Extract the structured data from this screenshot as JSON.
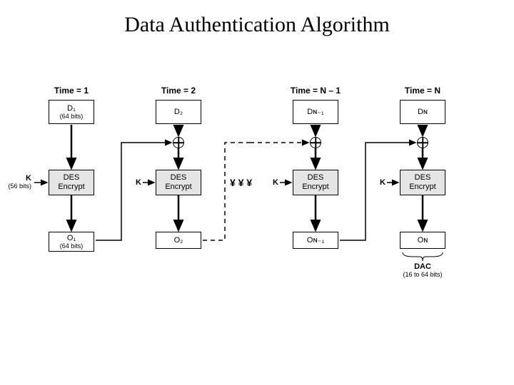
{
  "title": "Data Authentication Algorithm",
  "columns": [
    {
      "time": "Time = 1",
      "data_block": "D₁",
      "data_sub": "(64 bits)",
      "encrypt": "DES\nEncrypt",
      "output": "O₁",
      "output_sub": "(64 bits)"
    },
    {
      "time": "Time = 2",
      "data_block": "D₂",
      "encrypt": "DES\nEncrypt",
      "output": "O₂"
    },
    {
      "time": "Time = N – 1",
      "data_block": "Dɴ₋₁",
      "encrypt": "DES\nEncrypt",
      "output": "Oɴ₋₁"
    },
    {
      "time": "Time = N",
      "data_block": "Dɴ",
      "encrypt": "DES\nEncrypt",
      "output": "Oɴ"
    }
  ],
  "key_label": "K",
  "key_sub": "(56 bits)",
  "ellipsis": "¥  ¥  ¥",
  "dac_label": "DAC",
  "dac_sub": "(16 to 64 bits)"
}
